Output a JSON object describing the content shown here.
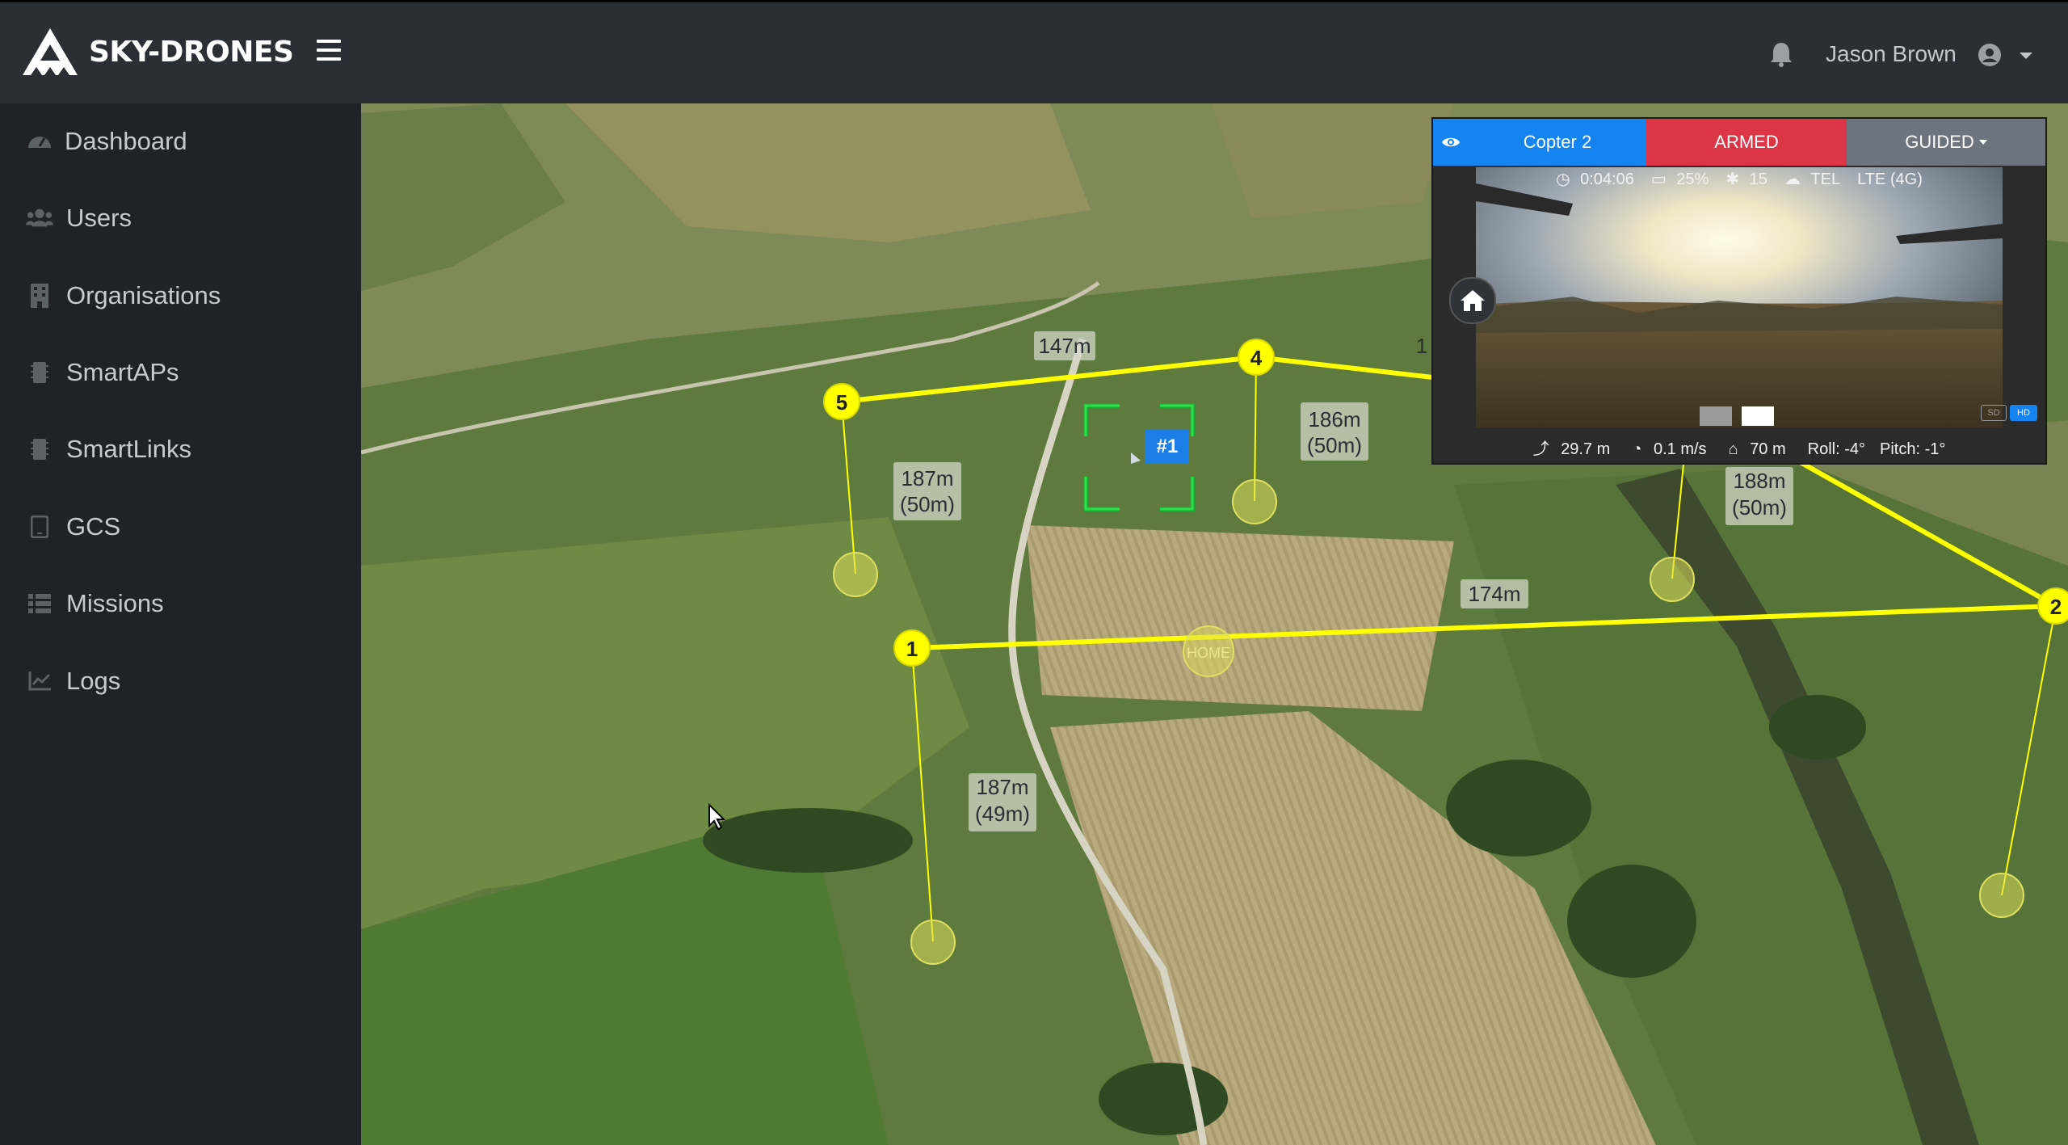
{
  "brand": {
    "name": "SKY-DRONES"
  },
  "header": {
    "user_name": "Jason Brown"
  },
  "sidebar": {
    "items": [
      {
        "label": "Dashboard",
        "icon": "gauge-icon"
      },
      {
        "label": "Users",
        "icon": "users-icon"
      },
      {
        "label": "Organisations",
        "icon": "building-icon"
      },
      {
        "label": "SmartAPs",
        "icon": "chip-icon"
      },
      {
        "label": "SmartLinks",
        "icon": "chip-icon"
      },
      {
        "label": "GCS",
        "icon": "tablet-icon"
      },
      {
        "label": "Missions",
        "icon": "list-icon"
      },
      {
        "label": "Logs",
        "icon": "chart-icon"
      }
    ]
  },
  "map": {
    "waypoints": [
      "1",
      "2",
      "4",
      "5"
    ],
    "home_label": "HOME",
    "target_label": "#1",
    "segment_labels": [
      {
        "distance": "147m"
      },
      {
        "distance": "186m",
        "sub": "(50m)"
      },
      {
        "distance": "187m",
        "sub": "(50m)"
      },
      {
        "distance": "188m",
        "sub": "(50m)"
      },
      {
        "distance": "174m"
      },
      {
        "distance": "187m",
        "sub": "(49m)"
      },
      {
        "distance": "1"
      }
    ]
  },
  "drone_panel": {
    "name": "Copter 2",
    "arm_state": "ARMED",
    "mode": "GUIDED",
    "flight_time": "0:04:06",
    "battery": "25%",
    "satellites": "15",
    "link": "TEL",
    "network": "LTE (4G)",
    "altitude": "29.7 m",
    "speed": "0.1 m/s",
    "home_distance": "70 m",
    "roll": "Roll: -4°",
    "pitch": "Pitch: -1°",
    "sd_label": "SD",
    "hd_label": "HD",
    "colors": {
      "name_bg": "#1584f0",
      "armed_bg": "#dc3545",
      "mode_bg": "#6c757d"
    }
  }
}
